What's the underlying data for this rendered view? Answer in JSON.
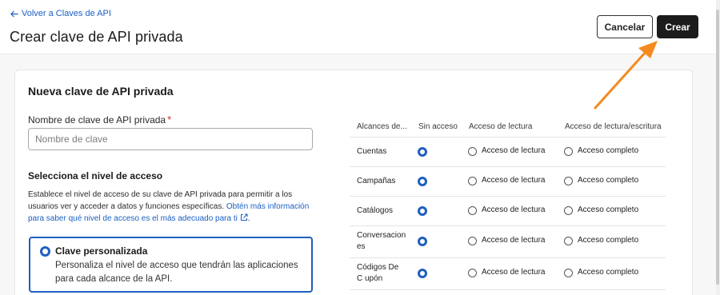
{
  "header": {
    "back_label": "Volver a Claves de API",
    "title": "Crear clave de API privada",
    "cancel_label": "Cancelar",
    "create_label": "Crear"
  },
  "form": {
    "card_title": "Nueva clave de API privada",
    "name_label": "Nombre de clave de API privada",
    "name_required_mark": "*",
    "name_placeholder": "Nombre de clave",
    "name_value": "",
    "access_title": "Selecciona el nivel de acceso",
    "access_desc": "Establece el nivel de acceso de su clave de API privada para permitir a los usuarios ver y acceder a datos y funciones específicas. ",
    "access_link": "Obtén más información para saber qué nivel de acceso es el más adecuado para ti",
    "access_desc_end": ".",
    "option_title": "Clave personalizada",
    "option_desc": "Personaliza el nivel de acceso que tendrán las aplicaciones para cada alcance de la API."
  },
  "scopes_table": {
    "headers": [
      "Alcances de...",
      "Sin acceso",
      "Acceso de lectura",
      "Acceso de lectura/escritura"
    ],
    "read_label": "Acceso de lectura",
    "full_label": "Acceso completo",
    "rows": [
      {
        "scope": "Cuentas",
        "selected": "none"
      },
      {
        "scope": "Campañas",
        "selected": "none"
      },
      {
        "scope": "Catálogos",
        "selected": "none"
      },
      {
        "scope": "Conversaciones",
        "scope_display": "Conversacion es",
        "selected": "none"
      },
      {
        "scope": "Códigos De Cupón",
        "scope_display": "Códigos De C upón",
        "selected": "none"
      }
    ]
  },
  "colors": {
    "accent": "#1f5fbf",
    "primary_button": "#1c1c1c",
    "annotation_arrow": "#f58a1f"
  }
}
